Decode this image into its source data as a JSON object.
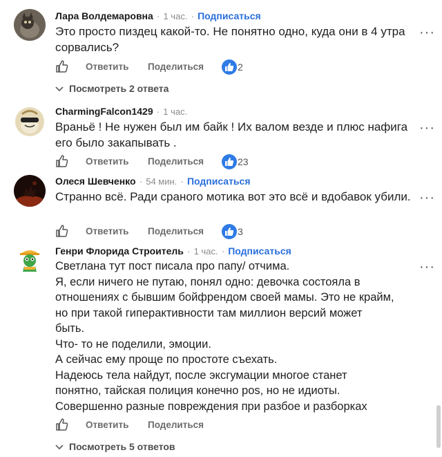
{
  "comments": [
    {
      "author": "Лара Волдемаровна",
      "time": "1 час.",
      "subscribe": "Подписаться",
      "text": "Это просто пиздец какой-то. Не понятно одно, куда они в 4 утра сорвались?",
      "reply_label": "Ответить",
      "share_label": "Поделиться",
      "reactions": "2",
      "replies_label": "Посмотреть 2 ответа"
    },
    {
      "author": "CharmingFalcon1429",
      "time": "1 час.",
      "text": "Враньё ! Не нужен был им байк ! Их валом везде и плюс нафига его было закапывать .",
      "reply_label": "Ответить",
      "share_label": "Поделиться",
      "reactions": "23"
    },
    {
      "author": "Олеся Шевченко",
      "time": "54 мин.",
      "subscribe": "Подписаться",
      "text": "Странно всё. Ради сраного мотика вот это всё и вдобавок убили.",
      "reply_label": "Ответить",
      "share_label": "Поделиться",
      "reactions": "3"
    },
    {
      "author": "Генри Флорида Строитель",
      "time": "1 час.",
      "subscribe": "Подписаться",
      "text_lines": [
        "Светлана тут пост писала про папу/ отчима.",
        "Я, если ничего не путаю, понял одно: девочка состояла в",
        "отношениях с бывшим бойфрендом своей мамы. Это не крайм,",
        "но при такой гиперактивности там миллион версий может",
        "быть.",
        "Что- то не поделили, эмоции.",
        "А сейчас ему проще по простоте съехать.",
        "Надеюсь тела найдут, после эксгумации многое станет",
        "понятно, тайская полиция конечно pos, но не идиоты.",
        "Совершенно разные повреждения при разбое и разборках"
      ],
      "reply_label": "Ответить",
      "share_label": "Поделиться",
      "replies_label": "Посмотреть 5 ответов"
    }
  ],
  "more_glyph": "···",
  "colors": {
    "accent": "#2a6fdc",
    "muted": "#6b6b6b",
    "reaction_blue": "#2f7be6"
  },
  "icons": {
    "like": "thumbs-up-outline-icon",
    "reaction": "thumbs-up-reaction-icon",
    "more": "more-dots-icon",
    "chevron": "chevron-down-icon"
  }
}
